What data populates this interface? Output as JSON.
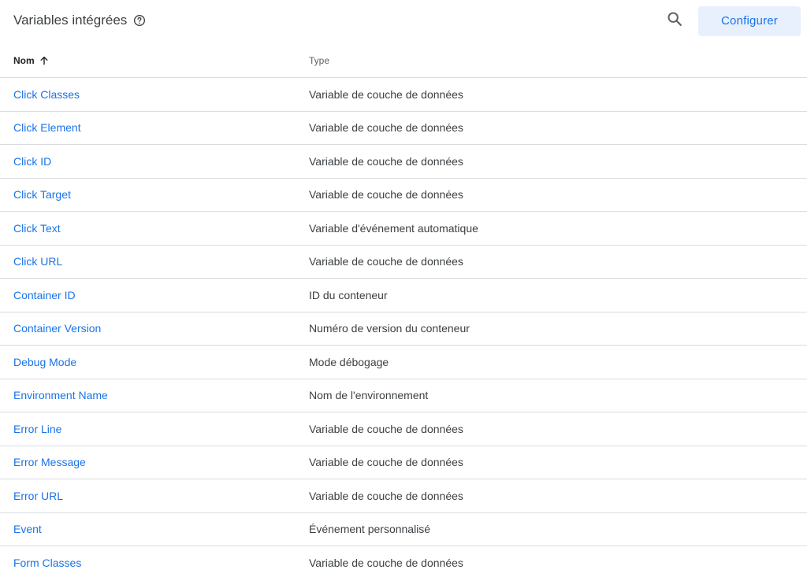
{
  "header": {
    "title": "Variables intégrées",
    "help_icon": "help-circle-icon",
    "search_icon": "search-icon",
    "configure_label": "Configurer"
  },
  "table": {
    "columns": {
      "name": "Nom",
      "type": "Type"
    },
    "sort_icon": "arrow-up-icon",
    "rows": [
      {
        "name": "Click Classes",
        "type": "Variable de couche de données"
      },
      {
        "name": "Click Element",
        "type": "Variable de couche de données"
      },
      {
        "name": "Click ID",
        "type": "Variable de couche de données"
      },
      {
        "name": "Click Target",
        "type": "Variable de couche de données"
      },
      {
        "name": "Click Text",
        "type": "Variable d'événement automatique"
      },
      {
        "name": "Click URL",
        "type": "Variable de couche de données"
      },
      {
        "name": "Container ID",
        "type": "ID du conteneur"
      },
      {
        "name": "Container Version",
        "type": "Numéro de version du conteneur"
      },
      {
        "name": "Debug Mode",
        "type": "Mode débogage"
      },
      {
        "name": "Environment Name",
        "type": "Nom de l'environnement"
      },
      {
        "name": "Error Line",
        "type": "Variable de couche de données"
      },
      {
        "name": "Error Message",
        "type": "Variable de couche de données"
      },
      {
        "name": "Error URL",
        "type": "Variable de couche de données"
      },
      {
        "name": "Event",
        "type": "Événement personnalisé"
      },
      {
        "name": "Form Classes",
        "type": "Variable de couche de données"
      }
    ]
  },
  "colors": {
    "link": "#1a73e8",
    "button_bg": "#e8f0fe",
    "divider": "#dadce0"
  }
}
